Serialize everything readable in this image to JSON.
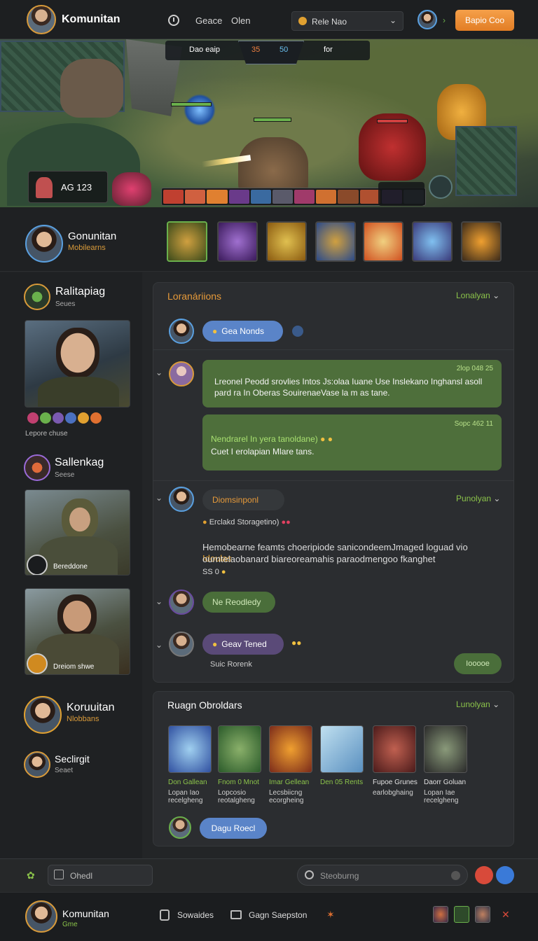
{
  "header": {
    "brand": "Komunitan",
    "nav": [
      "Geace",
      "Olen"
    ],
    "select_value": "Rele Nao",
    "cta_label": "Bapio Coo"
  },
  "banner": {
    "hud_left": "Dao  eaip",
    "hud_center_left": "35",
    "hud_center_right": "50",
    "hud_right": "for",
    "stat_label": "AG 123"
  },
  "profile": {
    "name": "Gonunitan",
    "subtitle": "Mobilearns"
  },
  "sidebar": {
    "items": [
      {
        "name": "Ralitapiag",
        "sub": "Seues",
        "caption": "Lepore chuse"
      },
      {
        "name": "Sallenkag",
        "sub": "Seese",
        "caption": "Bereddone"
      },
      {
        "caption": "Dreiom shwe"
      },
      {
        "name": "Koruuitan",
        "sub": "Nlobbans"
      },
      {
        "name": "Seclirgit",
        "sub": "Seaet"
      }
    ]
  },
  "chat": {
    "title": "Loranáriions",
    "right_label": "Lonalyan",
    "chip1": "Gea Nonds",
    "bubble1_time": "2lop 048 25",
    "bubble1_text": "Lreonel Peodd srovlies Intos Js:olaa Iuane Use Inslekano Inghansl asoll pard ra In Oberas SouirenaeVase la m as tane.",
    "bubble2_time": "Sopc 462 11",
    "bubble2_title": "Nendrarel In yera tanoldane)",
    "bubble2_text": "Cuet I erolapian Mlare tans.",
    "section2_chip": "Diomsinponl",
    "section2_right": "Punolyan",
    "section2_sub": "Erclakd Storagetino)",
    "section2_text_a": "Hemobearne feamts choeripiode sanicondeemJmaged loguad vio",
    "section2_text_hl": "Idoulas",
    "section2_text_b": "ourntelaobanard biareoreamahis paraodmengoo fkanghet",
    "section2_text_c": "SS 0",
    "chip_reply": "Ne Reodledy",
    "chip_tened": "Geav Tened",
    "sub_tened": "Suic Rorenk",
    "side_btn": "Iooooe"
  },
  "gallery": {
    "title": "Ruagn Obroldars",
    "right_label": "Lunolyan",
    "items": [
      {
        "title": "Don Gallean",
        "desc": "Lopan Iao recelgheng"
      },
      {
        "title": "Fnom 0 Mnot",
        "desc": "Lopcosio reotalgheng"
      },
      {
        "title": "Imar Gellean",
        "desc": "Lecsbiicng ecorgheing"
      },
      {
        "title": "Den 05 Rents",
        "desc": ""
      },
      {
        "title": "Fupoe Grunes",
        "desc": "earlobghaing"
      },
      {
        "title": "Daorr Goluan",
        "desc": "Lopan Iae recelgheng"
      }
    ],
    "chip": "Dagu Roecl"
  },
  "input_bar": {
    "left_placeholder": "Ohedl",
    "search_placeholder": "Steoburng"
  },
  "footer": {
    "name": "Komunitan",
    "sub": "Gme",
    "link1": "Sowaides",
    "link2": "Gagn Saepston"
  },
  "colors": {
    "accent": "#e69a3a",
    "green": "#8bc34a",
    "bubble": "#4e6f3b",
    "cta": "#f0902e"
  }
}
